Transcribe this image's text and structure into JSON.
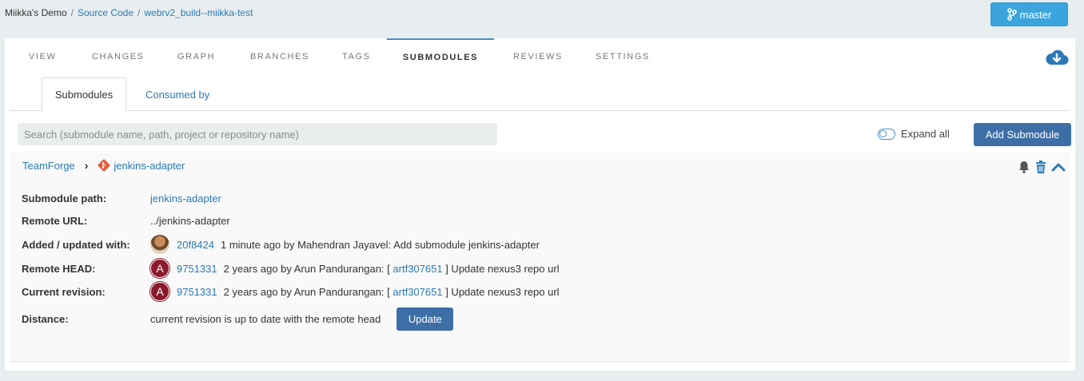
{
  "breadcrumb": {
    "project": "Miikka's Demo",
    "section": "Source Code",
    "repo": "webrv2_build--miikka-test",
    "sep": "/"
  },
  "branch_button": {
    "label": "master",
    "icon": "branch-icon"
  },
  "tabs": [
    {
      "label": "VIEW"
    },
    {
      "label": "CHANGES"
    },
    {
      "label": "GRAPH"
    },
    {
      "label": "BRANCHES"
    },
    {
      "label": "TAGS"
    },
    {
      "label": "SUBMODULES"
    },
    {
      "label": "REVIEWS"
    },
    {
      "label": "SETTINGS"
    }
  ],
  "subtabs": [
    {
      "label": "Submodules"
    },
    {
      "label": "Consumed by"
    }
  ],
  "search": {
    "placeholder": "Search (submodule name, path, project or repository name)"
  },
  "expand_all": {
    "label": "Expand all"
  },
  "add_button": {
    "label": "Add Submodule"
  },
  "submodule": {
    "project": "TeamForge",
    "chevron": "›",
    "repo": "jenkins-adapter",
    "rows": {
      "path": {
        "label": "Submodule path:",
        "value": "jenkins-adapter"
      },
      "remote_url": {
        "label": "Remote URL:",
        "value": "../jenkins-adapter"
      },
      "added": {
        "label": "Added / updated with:",
        "commit": "20f8424",
        "text": "1 minute ago by Mahendran Jayavel: Add submodule jenkins-adapter"
      },
      "remote_head": {
        "label": "Remote HEAD:",
        "avatar": "A",
        "commit": "9751331",
        "text_pre": "2 years ago by Arun Pandurangan: [",
        "artifact": "artf307651",
        "text_post": "] Update nexus3 repo url"
      },
      "current": {
        "label": "Current revision:",
        "avatar": "A",
        "commit": "9751331",
        "text_pre": "2 years ago by Arun Pandurangan: [",
        "artifact": "artf307651",
        "text_post": "] Update nexus3 repo url"
      },
      "distance": {
        "label": "Distance:",
        "value": "current revision is up to date with the remote head",
        "button": "Update"
      }
    }
  },
  "colors": {
    "accent": "#3d6fa6",
    "link": "#2a7ab8",
    "branch_button": "#3ba4dd",
    "repo_icon": "#e05a3a"
  }
}
